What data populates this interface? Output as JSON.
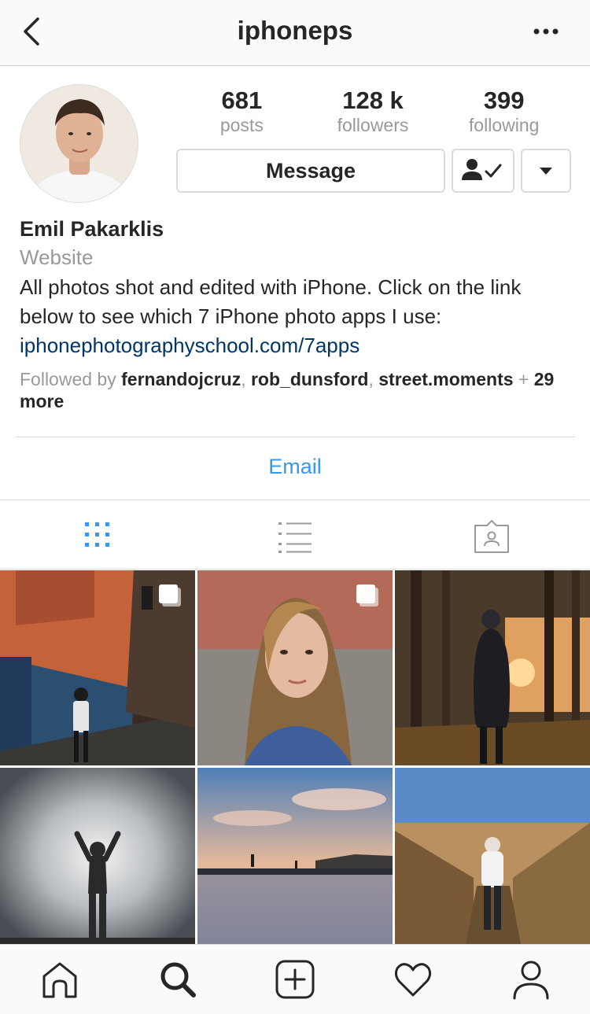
{
  "header": {
    "title": "iphoneps"
  },
  "profile": {
    "stats": [
      {
        "value": "681",
        "label": "posts"
      },
      {
        "value": "128 k",
        "label": "followers"
      },
      {
        "value": "399",
        "label": "following"
      }
    ],
    "message_label": "Message",
    "name": "Emil Pakarklis",
    "category": "Website",
    "bio": "All photos shot and edited with iPhone. Click on the link below to see which 7 iPhone photo apps I use:",
    "link": "iphonephotographyschool.com/7apps",
    "followed_by": {
      "prefix": "Followed by ",
      "users": [
        "fernandojcruz",
        "rob_dunsford",
        "street.moments"
      ],
      "separator": ", ",
      "plus": " + ",
      "more": "29 more"
    },
    "email_label": "Email"
  },
  "icons": {
    "back": "chevron-left-icon",
    "more": "ellipsis-icon",
    "following": "person-check-icon",
    "dropdown": "caret-down-icon",
    "tabs": [
      "grid-icon",
      "list-icon",
      "tagged-icon"
    ],
    "bottom": [
      "home-icon",
      "search-icon",
      "add-icon",
      "heart-icon",
      "profile-icon"
    ]
  },
  "colors": {
    "accent": "#3897f0",
    "link": "#003569",
    "muted": "#999999",
    "text": "#262626"
  },
  "posts": [
    {
      "subject": "street walker by orange wall",
      "multi": true
    },
    {
      "subject": "woman portrait",
      "multi": true
    },
    {
      "subject": "woman in forest at sunset",
      "multi": false
    },
    {
      "subject": "silhouette with raised arms",
      "multi": false
    },
    {
      "subject": "beach reflection at dusk",
      "multi": false
    },
    {
      "subject": "woman on wooden boardwalk",
      "multi": false
    }
  ]
}
